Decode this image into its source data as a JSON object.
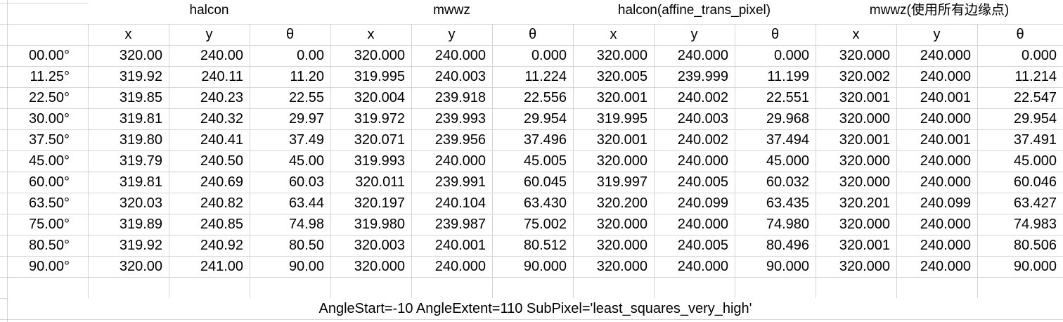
{
  "groups": [
    "halcon",
    "mwwz",
    "halcon(affine_trans_pixel)",
    "mwwz(使用所有边缘点)"
  ],
  "subheaders": [
    "x",
    "y",
    "θ",
    "x",
    "y",
    "θ",
    "x",
    "y",
    "θ",
    "x",
    "y",
    "θ"
  ],
  "rows": [
    {
      "angle": "00.00°",
      "values": [
        "320.00",
        "240.00",
        "0.00",
        "320.000",
        "240.000",
        "0.000",
        "320.000",
        "240.000",
        "0.000",
        "320.000",
        "240.000",
        "0.000"
      ]
    },
    {
      "angle": "11.25°",
      "values": [
        "319.92",
        "240.11",
        "11.20",
        "319.995",
        "240.003",
        "11.224",
        "320.005",
        "239.999",
        "11.199",
        "320.002",
        "240.000",
        "11.214"
      ]
    },
    {
      "angle": "22.50°",
      "values": [
        "319.85",
        "240.23",
        "22.55",
        "320.004",
        "239.918",
        "22.556",
        "320.001",
        "240.002",
        "22.551",
        "320.001",
        "240.001",
        "22.547"
      ]
    },
    {
      "angle": "30.00°",
      "values": [
        "319.81",
        "240.32",
        "29.97",
        "319.972",
        "239.993",
        "29.954",
        "319.995",
        "240.003",
        "29.968",
        "320.000",
        "240.000",
        "29.954"
      ]
    },
    {
      "angle": "37.50°",
      "values": [
        "319.80",
        "240.41",
        "37.49",
        "320.071",
        "239.956",
        "37.496",
        "320.001",
        "240.002",
        "37.494",
        "320.001",
        "240.001",
        "37.491"
      ]
    },
    {
      "angle": "45.00°",
      "values": [
        "319.79",
        "240.50",
        "45.00",
        "319.993",
        "240.000",
        "45.005",
        "320.000",
        "240.000",
        "45.000",
        "320.000",
        "240.000",
        "45.000"
      ]
    },
    {
      "angle": "60.00°",
      "values": [
        "319.81",
        "240.69",
        "60.03",
        "320.011",
        "239.991",
        "60.045",
        "319.997",
        "240.005",
        "60.032",
        "320.000",
        "240.000",
        "60.046"
      ]
    },
    {
      "angle": "63.50°",
      "values": [
        "320.03",
        "240.82",
        "63.44",
        "320.197",
        "240.104",
        "63.430",
        "320.200",
        "240.099",
        "63.435",
        "320.201",
        "240.099",
        "63.427"
      ]
    },
    {
      "angle": "75.00°",
      "values": [
        "319.89",
        "240.85",
        "74.98",
        "319.980",
        "239.987",
        "75.002",
        "320.000",
        "240.000",
        "74.980",
        "320.000",
        "240.000",
        "74.983"
      ]
    },
    {
      "angle": "80.50°",
      "values": [
        "319.92",
        "240.92",
        "80.50",
        "320.003",
        "240.001",
        "80.512",
        "320.000",
        "240.005",
        "80.496",
        "320.001",
        "240.000",
        "80.506"
      ]
    },
    {
      "angle": "90.00°",
      "values": [
        "320.00",
        "241.00",
        "90.00",
        "320.000",
        "240.000",
        "90.000",
        "320.000",
        "240.000",
        "90.000",
        "320.000",
        "240.000",
        "90.000"
      ]
    }
  ],
  "footnote": "AngleStart=-10  AngleExtent=110  SubPixel='least_squares_very_high'"
}
